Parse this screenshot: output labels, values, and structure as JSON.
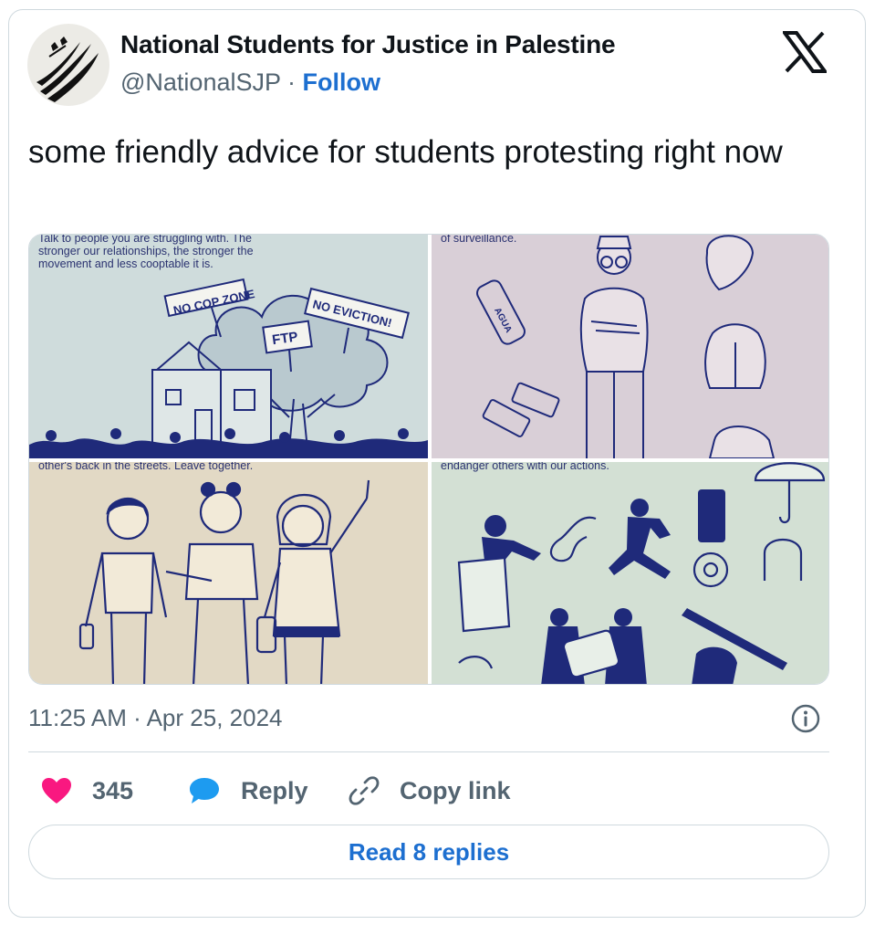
{
  "author": {
    "name": "National Students for Justice in Palestine",
    "handle": "@NationalSJP",
    "separator": "·",
    "follow_label": "Follow"
  },
  "tweet": {
    "text": "some friendly advice for students protesting right now",
    "timestamp": "11:25 AM · Apr 25, 2024"
  },
  "media": {
    "panels": [
      {
        "caption": "Talk to people you are struggling with. The stronger our relationships, the stronger the movement and less cooptable it is.",
        "signs": [
          "NO COP ZONE",
          "FTP",
          "NO EVICTION!"
        ]
      },
      {
        "caption": "of surveillance.",
        "bottle_label": "AGUA"
      },
      {
        "caption": "other's back in the streets. Leave together."
      },
      {
        "caption": "endanger others with our actions."
      }
    ]
  },
  "actions": {
    "like_count": "345",
    "reply_label": "Reply",
    "copy_link_label": "Copy link"
  },
  "read_replies_label": "Read 8 replies",
  "colors": {
    "link_blue": "#1d6fd0",
    "like_red": "#f91880",
    "reply_blue": "#1d9bf0",
    "muted": "#536471",
    "border": "#cfd9de",
    "ink": "#1f2a7a"
  },
  "icons": [
    "avatar-logo",
    "x-logo-icon",
    "info-icon",
    "heart-icon",
    "reply-bubble-icon",
    "link-icon"
  ]
}
